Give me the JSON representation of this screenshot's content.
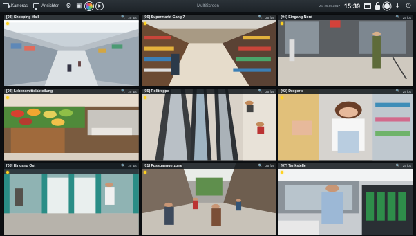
{
  "toolbar": {
    "buttons": [
      {
        "label": "Kameras",
        "icon": "camera-icon"
      },
      {
        "label": "Ansichten",
        "icon": "monitor-icon"
      }
    ],
    "tools": [
      "settings-icon",
      "display-icon",
      "color-wheel-icon",
      "play-icon"
    ],
    "app_title": "MultiScreen",
    "date": "Mo, 25.09.2017",
    "clock": "15:39",
    "right_icons": [
      "window-icon",
      "lock-icon",
      "gear-icon",
      "download-icon",
      "power-icon"
    ]
  },
  "cameras": [
    {
      "label": "[03] Shopping Mall",
      "fps": "25 fps"
    },
    {
      "label": "[06] Supermarkt Gang 7",
      "fps": "25 fps"
    },
    {
      "label": "[04] Eingang Nord",
      "fps": "25 fps"
    },
    {
      "label": "[03] Lebensmittelabteilung",
      "fps": "25 fps"
    },
    {
      "label": "[05] Rolltreppe",
      "fps": "25 fps"
    },
    {
      "label": "[02] Drogerie",
      "fps": "25 fps"
    },
    {
      "label": "[08] Eingang Ost",
      "fps": "25 fps"
    },
    {
      "label": "[01] Fussgaengerzone",
      "fps": "25 fps"
    },
    {
      "label": "[07] Tankstelle",
      "fps": "25 fps"
    }
  ],
  "colors": {
    "record_indicator": "#ffd21f",
    "toolbar_bg": "#1d2328"
  }
}
